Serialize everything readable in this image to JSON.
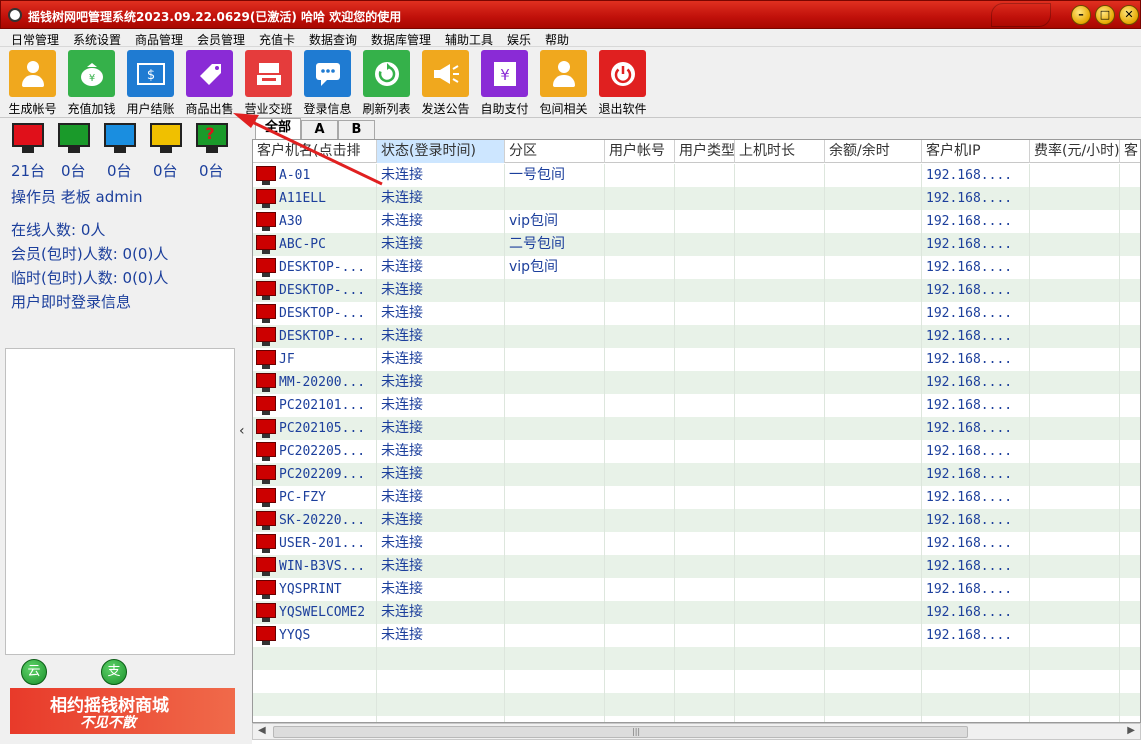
{
  "window": {
    "title": "摇钱树网吧管理系统2023.09.22.0629(已激活)  哈哈 欢迎您的使用",
    "minimize": "–",
    "maximize": "□",
    "close": "✕"
  },
  "menu": [
    "日常管理",
    "系统设置",
    "商品管理",
    "会员管理",
    "充值卡",
    "数据查询",
    "数据库管理",
    "辅助工具",
    "娱乐",
    "帮助"
  ],
  "toolbar": [
    {
      "label": "生成帐号",
      "color": "#f0a81e",
      "icon": "person-icon"
    },
    {
      "label": "充值加钱",
      "color": "#35b14a",
      "icon": "money-bag-icon"
    },
    {
      "label": "用户结账",
      "color": "#1f7bd2",
      "icon": "bill-icon"
    },
    {
      "label": "商品出售",
      "color": "#8a2bd6",
      "icon": "sale-tag-icon"
    },
    {
      "label": "营业交班",
      "color": "#e53c3c",
      "icon": "register-icon"
    },
    {
      "label": "登录信息",
      "color": "#1f7bd2",
      "icon": "chat-icon"
    },
    {
      "label": "刷新列表",
      "color": "#35b14a",
      "icon": "refresh-icon"
    },
    {
      "label": "发送公告",
      "color": "#f0a81e",
      "icon": "megaphone-icon"
    },
    {
      "label": "自助支付",
      "color": "#8a2bd6",
      "icon": "yuan-icon"
    },
    {
      "label": "包间相关",
      "color": "#f0a81e",
      "icon": "person-icon"
    },
    {
      "label": "退出软件",
      "color": "#e02020",
      "icon": "power-icon"
    }
  ],
  "stats": [
    {
      "count": "21台",
      "color": "#e0101a",
      "name": "offline"
    },
    {
      "count": "0台",
      "color": "#1a9a2a",
      "name": "online"
    },
    {
      "count": "0台",
      "color": "#1a8ee0",
      "name": "member"
    },
    {
      "count": "0台",
      "color": "#f0c000",
      "name": "temp"
    },
    {
      "count": "0台",
      "color": "#1a9a2a",
      "name": "unknown",
      "glyph": "?"
    }
  ],
  "operator": "操作员  老板  admin",
  "online_count": "在线人数: 0人",
  "member_count": "会员(包时)人数: 0(0)人",
  "temp_count": "临时(包时)人数: 0(0)人",
  "login_info": "用户即时登录信息",
  "bottom_buttons": [
    "云",
    "支付"
  ],
  "banner": {
    "line1": "相约摇钱树商城",
    "line2": "不见不散"
  },
  "splitter_arrow": "‹",
  "tabs": [
    "全部",
    "A",
    "B"
  ],
  "columns": [
    "客户机名(点击排",
    "状态(登录时间)",
    "分区",
    "用户帐号",
    "用户类型",
    "上机时长",
    "余额/余时",
    "客户机IP",
    "费率(元/小时)",
    "客"
  ],
  "rows": [
    {
      "name": "A-01",
      "status": "未连接",
      "zone": "一号包间",
      "ip": "192.168...."
    },
    {
      "name": "A11ELL",
      "status": "未连接",
      "zone": "",
      "ip": "192.168...."
    },
    {
      "name": "A30",
      "status": "未连接",
      "zone": "vip包间",
      "ip": "192.168...."
    },
    {
      "name": "ABC-PC",
      "status": "未连接",
      "zone": "二号包间",
      "ip": "192.168...."
    },
    {
      "name": "DESKTOP-...",
      "status": "未连接",
      "zone": "vip包间",
      "ip": "192.168...."
    },
    {
      "name": "DESKTOP-...",
      "status": "未连接",
      "zone": "",
      "ip": "192.168...."
    },
    {
      "name": "DESKTOP-...",
      "status": "未连接",
      "zone": "",
      "ip": "192.168...."
    },
    {
      "name": "DESKTOP-...",
      "status": "未连接",
      "zone": "",
      "ip": "192.168...."
    },
    {
      "name": "JF",
      "status": "未连接",
      "zone": "",
      "ip": "192.168...."
    },
    {
      "name": "MM-20200...",
      "status": "未连接",
      "zone": "",
      "ip": "192.168...."
    },
    {
      "name": "PC202101...",
      "status": "未连接",
      "zone": "",
      "ip": "192.168...."
    },
    {
      "name": "PC202105...",
      "status": "未连接",
      "zone": "",
      "ip": "192.168...."
    },
    {
      "name": "PC202205...",
      "status": "未连接",
      "zone": "",
      "ip": "192.168...."
    },
    {
      "name": "PC202209...",
      "status": "未连接",
      "zone": "",
      "ip": "192.168...."
    },
    {
      "name": "PC-FZY",
      "status": "未连接",
      "zone": "",
      "ip": "192.168...."
    },
    {
      "name": "SK-20220...",
      "status": "未连接",
      "zone": "",
      "ip": "192.168...."
    },
    {
      "name": "USER-201...",
      "status": "未连接",
      "zone": "",
      "ip": "192.168...."
    },
    {
      "name": "WIN-B3VS...",
      "status": "未连接",
      "zone": "",
      "ip": "192.168...."
    },
    {
      "name": "YQSPRINT",
      "status": "未连接",
      "zone": "",
      "ip": "192.168...."
    },
    {
      "name": "YQSWELCOME2",
      "status": "未连接",
      "zone": "",
      "ip": "192.168...."
    },
    {
      "name": "YYQS",
      "status": "未连接",
      "zone": "",
      "ip": "192.168...."
    }
  ],
  "colors": {
    "titlebar": "#c0100a",
    "text_blue": "#1c3f9c",
    "row_alt": "#e8f2e8",
    "annotation_arrow": "#e02020"
  }
}
